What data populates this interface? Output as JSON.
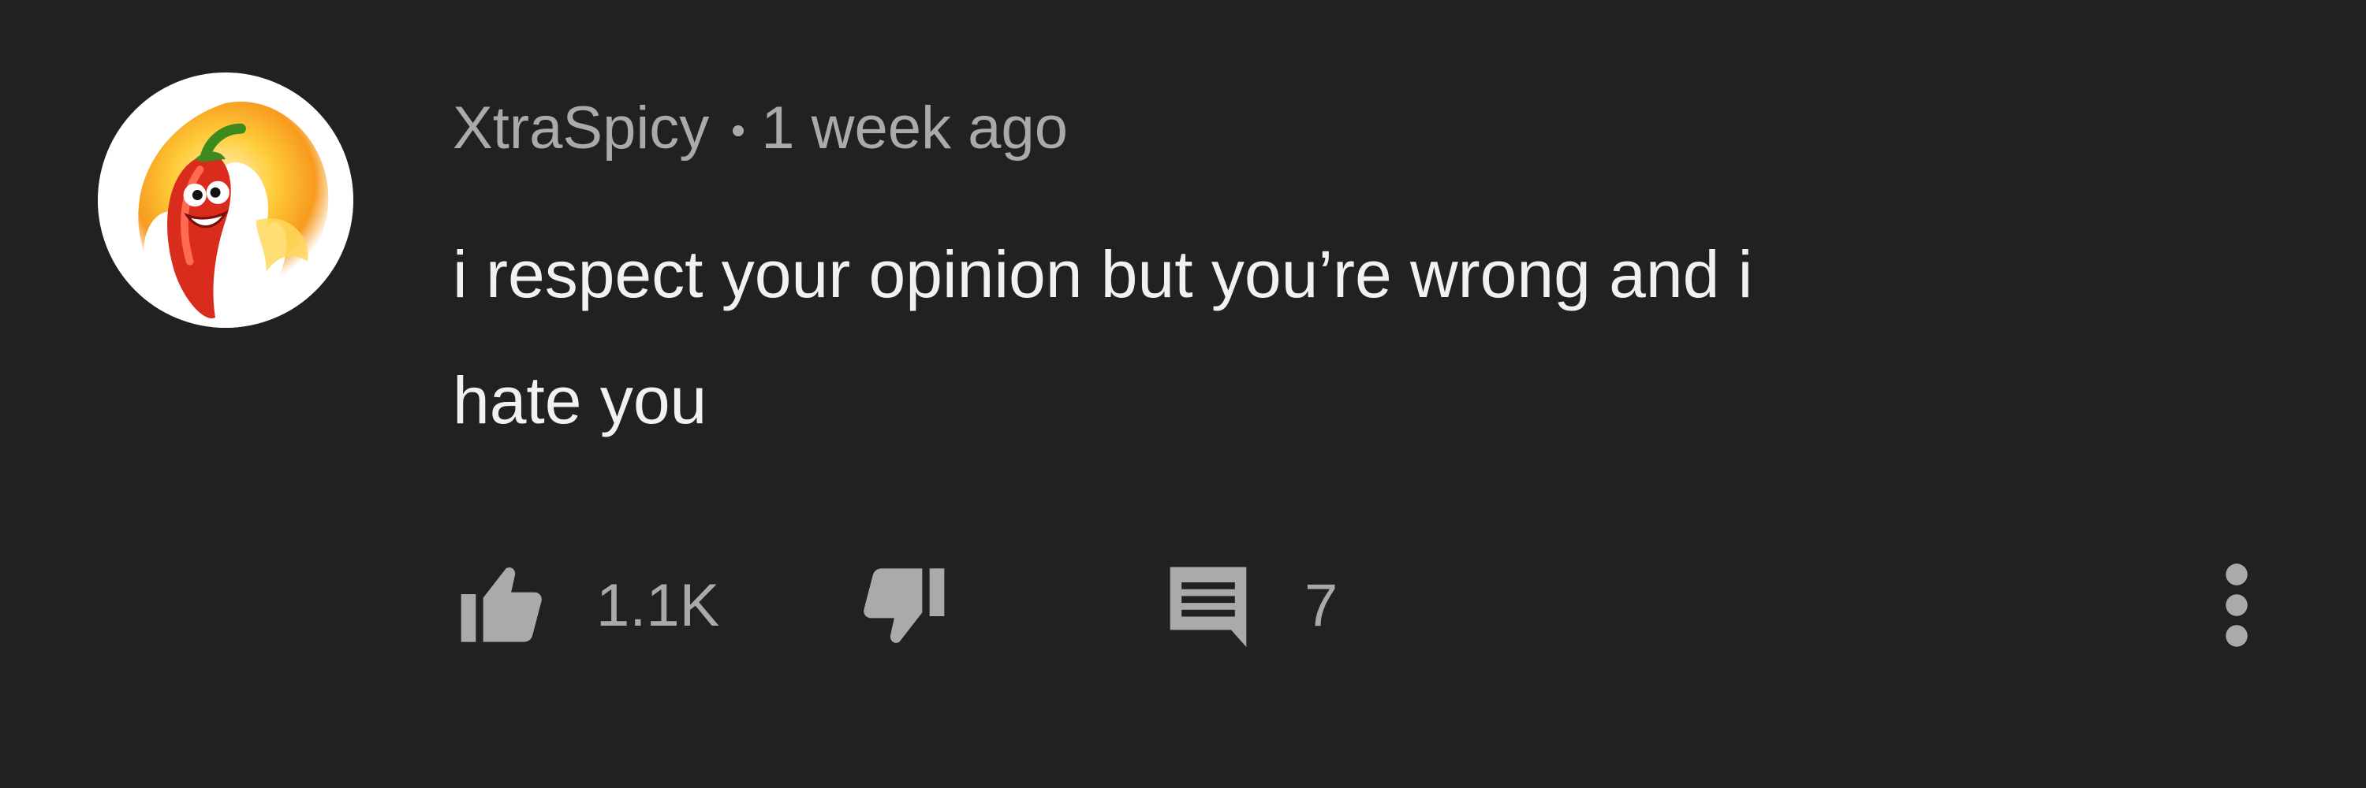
{
  "comment": {
    "author": "XtraSpicy",
    "timestamp": "1 week ago",
    "text": "i respect your opinion but you’re wrong and i\nhate you",
    "avatar_icon": "chili-pepper-avatar",
    "like_count": "1.1K",
    "reply_count": "7",
    "icons": {
      "like": "thumbs-up-icon",
      "dislike": "thumbs-down-icon",
      "reply": "comment-bubble-icon",
      "more": "vertical-ellipsis-icon"
    }
  },
  "colors": {
    "background": "#212121",
    "primary_text": "#f1f1f1",
    "secondary_text": "#aaaaaa",
    "icon": "#aaaaaa"
  }
}
